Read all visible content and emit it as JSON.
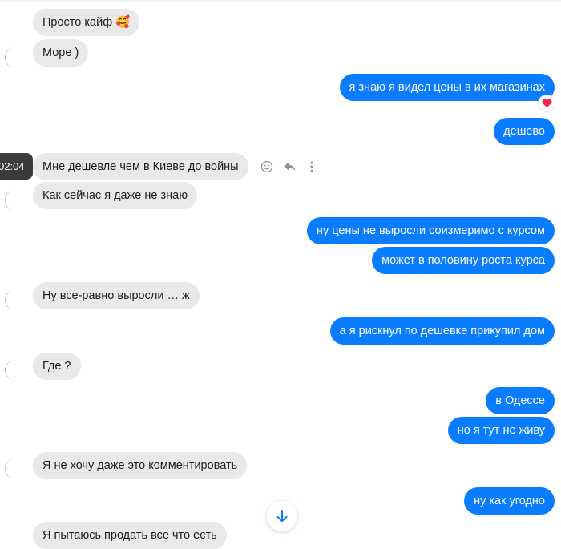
{
  "messages": [
    {
      "side": "in",
      "text": "Просто кайф",
      "emoji": "🥰"
    },
    {
      "side": "in",
      "text": "Море )"
    },
    {
      "side": "out",
      "text": "я знаю я видел цены в их магазинах",
      "reaction": "❤️"
    },
    {
      "side": "out",
      "text": "дешево"
    },
    {
      "side": "in",
      "text": "Мне дешевле чем в Киеве до войны"
    },
    {
      "side": "in",
      "text": "Как сейчас я даже не знаю"
    },
    {
      "side": "out",
      "text": "ну цены не выросли соизмеримо с курсом"
    },
    {
      "side": "out",
      "text": "может в половину роста курса"
    },
    {
      "side": "in",
      "text": "Ну все-равно выросли … ж"
    },
    {
      "side": "out",
      "text": "а я рискнул по дешевке прикупил дом"
    },
    {
      "side": "in",
      "text": "Где ?"
    },
    {
      "side": "out",
      "text": "в Одессе"
    },
    {
      "side": "out",
      "text": "но я тут не живу"
    },
    {
      "side": "in",
      "text": "Я не хочу даже это комментировать"
    },
    {
      "side": "out",
      "text": "ну как угодно"
    },
    {
      "side": "in",
      "text": "Я пытаюсь продать все что есть"
    }
  ],
  "hover_time": "02:04",
  "icons": {
    "react": "smile-icon",
    "reply": "reply-icon",
    "more": "more-vertical-icon",
    "scroll": "arrow-down-icon"
  },
  "colors": {
    "outgoing_bubble": "#0a7cff",
    "incoming_bubble": "#e9e9ec",
    "reaction_heart": "#f0284a"
  }
}
